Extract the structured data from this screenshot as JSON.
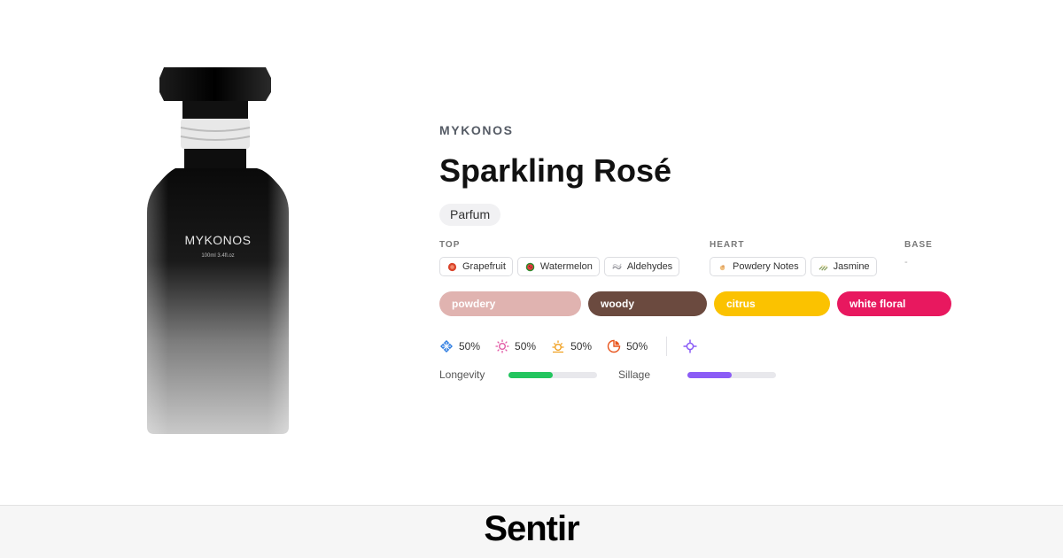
{
  "product": {
    "brand": "MYKONOS",
    "name": "Sparkling Rosé",
    "concentration": "Parfum",
    "bottle_label": "MYKONOS",
    "bottle_sublabel": "100ml 3.4fl.oz"
  },
  "notes": {
    "top": {
      "label": "TOP",
      "items": [
        {
          "name": "Grapefruit",
          "icon": "grapefruit-icon",
          "color": "#d9442b"
        },
        {
          "name": "Watermelon",
          "icon": "watermelon-icon",
          "color": "#2f8a2f"
        },
        {
          "name": "Aldehydes",
          "icon": "aldehydes-icon",
          "color": "#9a9aa0"
        }
      ]
    },
    "heart": {
      "label": "HEART",
      "items": [
        {
          "name": "Powdery Notes",
          "icon": "powdery-notes-icon",
          "color": "#e0a060"
        },
        {
          "name": "Jasmine",
          "icon": "jasmine-icon",
          "color": "#8aa060"
        }
      ]
    },
    "base": {
      "label": "BASE",
      "empty": "-"
    }
  },
  "accords": [
    {
      "name": "powdery",
      "color": "#e0b3b0"
    },
    {
      "name": "woody",
      "color": "#6b4a3f"
    },
    {
      "name": "citrus",
      "color": "#fbc200"
    },
    {
      "name": "white floral",
      "color": "#e8185f"
    }
  ],
  "seasons": [
    {
      "icon": "winter-snowflake-icon",
      "value": "50%",
      "color": "#2f7de1"
    },
    {
      "icon": "spring-sun-icon",
      "value": "50%",
      "color": "#e25aa6"
    },
    {
      "icon": "summer-sun-icon",
      "value": "50%",
      "color": "#f0a020"
    },
    {
      "icon": "fall-leaf-icon",
      "value": "50%",
      "color": "#e8541c"
    }
  ],
  "extra_icon": {
    "icon": "sparkle-icon",
    "color": "#8a5cf6"
  },
  "performance": {
    "longevity": {
      "label": "Longevity",
      "level": 0.5,
      "color": "#22c55e"
    },
    "sillage": {
      "label": "Sillage",
      "level": 0.5,
      "color": "#8b5cf6"
    }
  },
  "footer": {
    "logo": "Sentir"
  }
}
